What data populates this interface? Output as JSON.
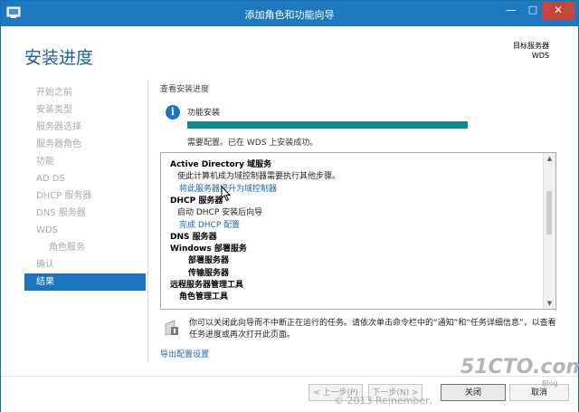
{
  "window": {
    "title": "添加角色和功能向导",
    "minimize_glyph": "—",
    "maximize_glyph": "□",
    "close_glyph": "✕"
  },
  "header": {
    "page_title": "安装进度",
    "target_server_label": "目标服务器",
    "target_server_name": "WDS"
  },
  "sidebar": {
    "items": [
      {
        "label": "开始之前",
        "state": "disabled",
        "indent": false
      },
      {
        "label": "安装类型",
        "state": "disabled",
        "indent": false
      },
      {
        "label": "服务器选择",
        "state": "disabled",
        "indent": false
      },
      {
        "label": "服务器角色",
        "state": "disabled",
        "indent": false
      },
      {
        "label": "功能",
        "state": "disabled",
        "indent": false
      },
      {
        "label": "AD DS",
        "state": "disabled",
        "indent": false
      },
      {
        "label": "DHCP 服务器",
        "state": "disabled",
        "indent": false
      },
      {
        "label": "DNS 服务器",
        "state": "disabled",
        "indent": false
      },
      {
        "label": "WDS",
        "state": "disabled",
        "indent": false
      },
      {
        "label": "角色服务",
        "state": "disabled",
        "indent": true
      },
      {
        "label": "确认",
        "state": "disabled",
        "indent": false
      },
      {
        "label": "结果",
        "state": "active",
        "indent": false
      }
    ]
  },
  "main": {
    "section_label": "查看安装进度",
    "info_icon_glyph": "i",
    "feature_label": "功能安装",
    "progress_fraction": 1.0,
    "status_text": "需要配置。已在 WDS 上安装成功。",
    "results": [
      {
        "type": "head",
        "text": "Active Directory 域服务",
        "x": 10
      },
      {
        "type": "text",
        "text": "使此计算机成为域控制器需要执行其他步骤。",
        "x": 18
      },
      {
        "type": "link",
        "text": "将此服务器提升为域控制器",
        "x": 20
      },
      {
        "type": "head",
        "text": "DHCP 服务器",
        "x": 10
      },
      {
        "type": "text",
        "text": "启动 DHCP 安装后向导",
        "x": 18
      },
      {
        "type": "link",
        "text": "完成 DHCP 配置",
        "x": 20
      },
      {
        "type": "head",
        "text": "DNS 服务器",
        "x": 10
      },
      {
        "type": "head",
        "text": "Windows 部署服务",
        "x": 10
      },
      {
        "type": "head",
        "text": "部署服务器",
        "x": 30
      },
      {
        "type": "head",
        "text": "传输服务器",
        "x": 30
      },
      {
        "type": "head",
        "text": "远程服务器管理工具",
        "x": 10
      },
      {
        "type": "head",
        "text": "角色管理工具",
        "x": 20
      }
    ],
    "scroll_up_glyph": "▲",
    "scroll_down_glyph": "▼",
    "notice_text": "你可以关闭此向导而不中断正在运行的任务。请依次单击命令栏中的“通知”和“任务详细信息”，以查看任务进度或再次打开此页面。",
    "export_link": "导出配置设置"
  },
  "footer": {
    "prev_label": "< 上一步(P)",
    "next_label": "下一步(N) >",
    "close_label": "关闭",
    "cancel_label": "取消"
  },
  "watermark": {
    "logo": "51CTO.com",
    "sub": "Blog",
    "copyright": "© 2013 Reinember,"
  }
}
